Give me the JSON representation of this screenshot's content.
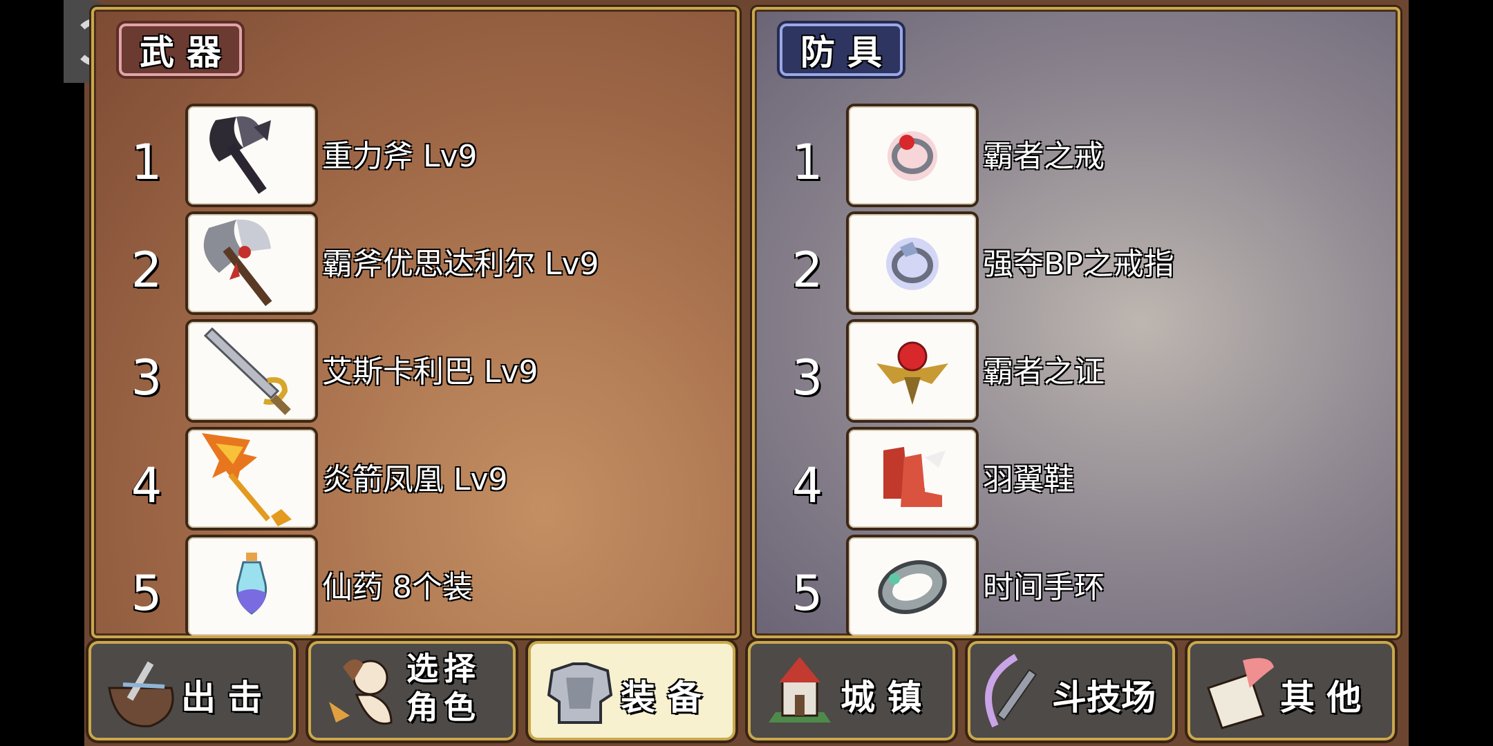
{
  "weapons": {
    "title": "武器",
    "items": [
      {
        "num": "1",
        "name": "重力斧 Lv9",
        "icon": "gravity-axe-icon"
      },
      {
        "num": "2",
        "name": "霸斧优思达利尔 Lv9",
        "icon": "battle-axe-icon"
      },
      {
        "num": "3",
        "name": "艾斯卡利巴 Lv9",
        "icon": "sword-icon"
      },
      {
        "num": "4",
        "name": "炎箭凤凰 Lv9",
        "icon": "flame-spear-icon"
      },
      {
        "num": "5",
        "name": "仙药 8个装",
        "icon": "potion-icon"
      }
    ]
  },
  "armor": {
    "title": "防具",
    "items": [
      {
        "num": "1",
        "name": "霸者之戒",
        "icon": "red-ring-icon"
      },
      {
        "num": "2",
        "name": "强夺BP之戒指",
        "icon": "blue-ring-icon"
      },
      {
        "num": "3",
        "name": "霸者之证",
        "icon": "emblem-icon"
      },
      {
        "num": "4",
        "name": "羽翼鞋",
        "icon": "winged-boots-icon"
      },
      {
        "num": "5",
        "name": "时间手环",
        "icon": "bracelet-icon"
      }
    ]
  },
  "nav": {
    "sortie": "出 击",
    "select_char_1": "选择",
    "select_char_2": "角色",
    "equip": "装 备",
    "town": "城 镇",
    "arena": "斗技场",
    "other": "其 他",
    "active": "equip"
  },
  "colors": {
    "frame_gold": "#c9a84e",
    "weapons_bg": "#a66f4c",
    "armor_bg": "#8f8891",
    "active_tab": "#f7f1cf"
  }
}
